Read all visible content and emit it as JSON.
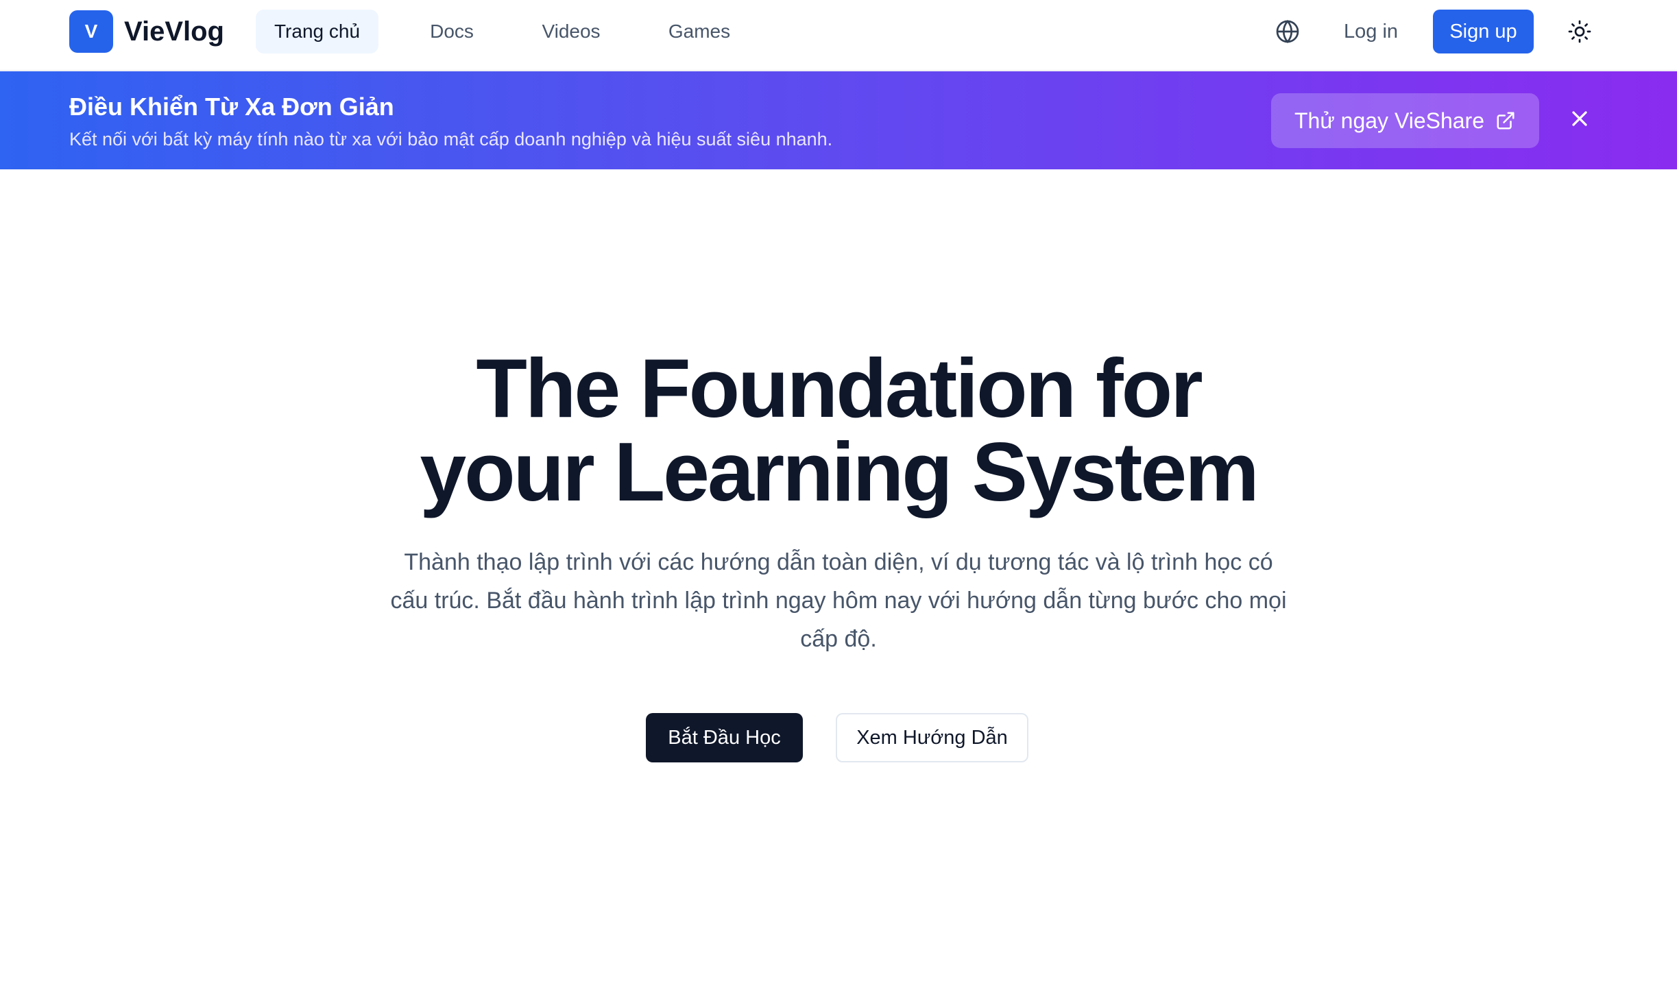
{
  "nav": {
    "logo_letter": "V",
    "brand": "VieVlog",
    "links": [
      {
        "label": "Trang chủ",
        "active": true
      },
      {
        "label": "Docs",
        "active": false
      },
      {
        "label": "Videos",
        "active": false
      },
      {
        "label": "Games",
        "active": false
      }
    ],
    "language_icon": "globe-icon",
    "login_label": "Log in",
    "signup_label": "Sign up",
    "theme_icon": "sun-icon"
  },
  "banner": {
    "title": "Điều Khiển Từ Xa Đơn Giản",
    "subtitle": "Kết nối với bất kỳ máy tính nào từ xa với bảo mật cấp doanh nghiệp và hiệu suất siêu nhanh.",
    "cta_label": "Thử ngay VieShare",
    "cta_icon": "external-link-icon",
    "close_icon": "close-icon"
  },
  "hero": {
    "title_line1": "The Foundation for",
    "title_line2": "your Learning System",
    "description": "Thành thạo lập trình với các hướng dẫn toàn diện, ví dụ tương tác và lộ trình học có cấu trúc. Bắt đầu hành trình lập trình ngay hôm nay với hướng dẫn từng bước cho mọi cấp độ.",
    "primary_button": "Bắt Đầu Học",
    "secondary_button": "Xem Hướng Dẫn"
  },
  "colors": {
    "accent": "#2563eb",
    "banner_start": "#2f63f1",
    "banner_end": "#8a2cf0",
    "dark": "#0f172a"
  }
}
